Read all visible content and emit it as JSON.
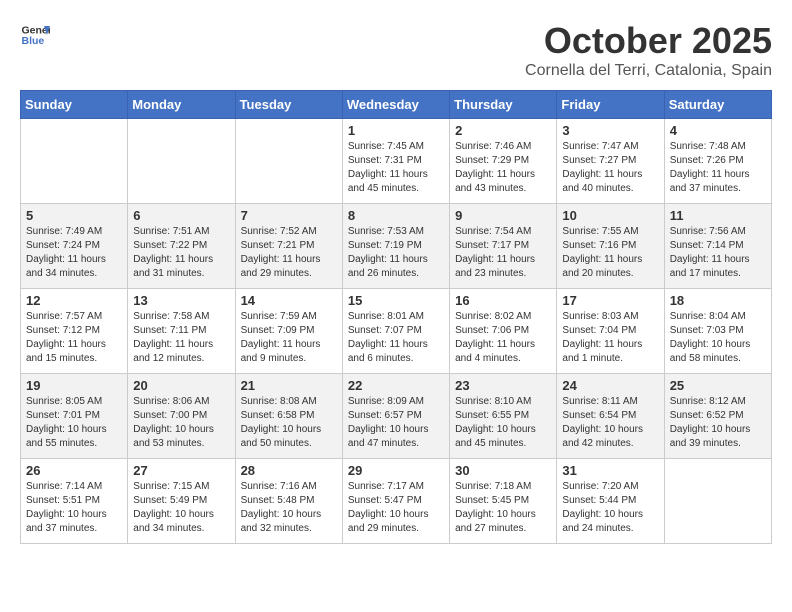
{
  "header": {
    "logo_line1": "General",
    "logo_line2": "Blue",
    "month": "October 2025",
    "location": "Cornella del Terri, Catalonia, Spain"
  },
  "days_of_week": [
    "Sunday",
    "Monday",
    "Tuesday",
    "Wednesday",
    "Thursday",
    "Friday",
    "Saturday"
  ],
  "weeks": [
    [
      {
        "day": "",
        "info": ""
      },
      {
        "day": "",
        "info": ""
      },
      {
        "day": "",
        "info": ""
      },
      {
        "day": "1",
        "info": "Sunrise: 7:45 AM\nSunset: 7:31 PM\nDaylight: 11 hours and 45 minutes."
      },
      {
        "day": "2",
        "info": "Sunrise: 7:46 AM\nSunset: 7:29 PM\nDaylight: 11 hours and 43 minutes."
      },
      {
        "day": "3",
        "info": "Sunrise: 7:47 AM\nSunset: 7:27 PM\nDaylight: 11 hours and 40 minutes."
      },
      {
        "day": "4",
        "info": "Sunrise: 7:48 AM\nSunset: 7:26 PM\nDaylight: 11 hours and 37 minutes."
      }
    ],
    [
      {
        "day": "5",
        "info": "Sunrise: 7:49 AM\nSunset: 7:24 PM\nDaylight: 11 hours and 34 minutes."
      },
      {
        "day": "6",
        "info": "Sunrise: 7:51 AM\nSunset: 7:22 PM\nDaylight: 11 hours and 31 minutes."
      },
      {
        "day": "7",
        "info": "Sunrise: 7:52 AM\nSunset: 7:21 PM\nDaylight: 11 hours and 29 minutes."
      },
      {
        "day": "8",
        "info": "Sunrise: 7:53 AM\nSunset: 7:19 PM\nDaylight: 11 hours and 26 minutes."
      },
      {
        "day": "9",
        "info": "Sunrise: 7:54 AM\nSunset: 7:17 PM\nDaylight: 11 hours and 23 minutes."
      },
      {
        "day": "10",
        "info": "Sunrise: 7:55 AM\nSunset: 7:16 PM\nDaylight: 11 hours and 20 minutes."
      },
      {
        "day": "11",
        "info": "Sunrise: 7:56 AM\nSunset: 7:14 PM\nDaylight: 11 hours and 17 minutes."
      }
    ],
    [
      {
        "day": "12",
        "info": "Sunrise: 7:57 AM\nSunset: 7:12 PM\nDaylight: 11 hours and 15 minutes."
      },
      {
        "day": "13",
        "info": "Sunrise: 7:58 AM\nSunset: 7:11 PM\nDaylight: 11 hours and 12 minutes."
      },
      {
        "day": "14",
        "info": "Sunrise: 7:59 AM\nSunset: 7:09 PM\nDaylight: 11 hours and 9 minutes."
      },
      {
        "day": "15",
        "info": "Sunrise: 8:01 AM\nSunset: 7:07 PM\nDaylight: 11 hours and 6 minutes."
      },
      {
        "day": "16",
        "info": "Sunrise: 8:02 AM\nSunset: 7:06 PM\nDaylight: 11 hours and 4 minutes."
      },
      {
        "day": "17",
        "info": "Sunrise: 8:03 AM\nSunset: 7:04 PM\nDaylight: 11 hours and 1 minute."
      },
      {
        "day": "18",
        "info": "Sunrise: 8:04 AM\nSunset: 7:03 PM\nDaylight: 10 hours and 58 minutes."
      }
    ],
    [
      {
        "day": "19",
        "info": "Sunrise: 8:05 AM\nSunset: 7:01 PM\nDaylight: 10 hours and 55 minutes."
      },
      {
        "day": "20",
        "info": "Sunrise: 8:06 AM\nSunset: 7:00 PM\nDaylight: 10 hours and 53 minutes."
      },
      {
        "day": "21",
        "info": "Sunrise: 8:08 AM\nSunset: 6:58 PM\nDaylight: 10 hours and 50 minutes."
      },
      {
        "day": "22",
        "info": "Sunrise: 8:09 AM\nSunset: 6:57 PM\nDaylight: 10 hours and 47 minutes."
      },
      {
        "day": "23",
        "info": "Sunrise: 8:10 AM\nSunset: 6:55 PM\nDaylight: 10 hours and 45 minutes."
      },
      {
        "day": "24",
        "info": "Sunrise: 8:11 AM\nSunset: 6:54 PM\nDaylight: 10 hours and 42 minutes."
      },
      {
        "day": "25",
        "info": "Sunrise: 8:12 AM\nSunset: 6:52 PM\nDaylight: 10 hours and 39 minutes."
      }
    ],
    [
      {
        "day": "26",
        "info": "Sunrise: 7:14 AM\nSunset: 5:51 PM\nDaylight: 10 hours and 37 minutes."
      },
      {
        "day": "27",
        "info": "Sunrise: 7:15 AM\nSunset: 5:49 PM\nDaylight: 10 hours and 34 minutes."
      },
      {
        "day": "28",
        "info": "Sunrise: 7:16 AM\nSunset: 5:48 PM\nDaylight: 10 hours and 32 minutes."
      },
      {
        "day": "29",
        "info": "Sunrise: 7:17 AM\nSunset: 5:47 PM\nDaylight: 10 hours and 29 minutes."
      },
      {
        "day": "30",
        "info": "Sunrise: 7:18 AM\nSunset: 5:45 PM\nDaylight: 10 hours and 27 minutes."
      },
      {
        "day": "31",
        "info": "Sunrise: 7:20 AM\nSunset: 5:44 PM\nDaylight: 10 hours and 24 minutes."
      },
      {
        "day": "",
        "info": ""
      }
    ]
  ]
}
